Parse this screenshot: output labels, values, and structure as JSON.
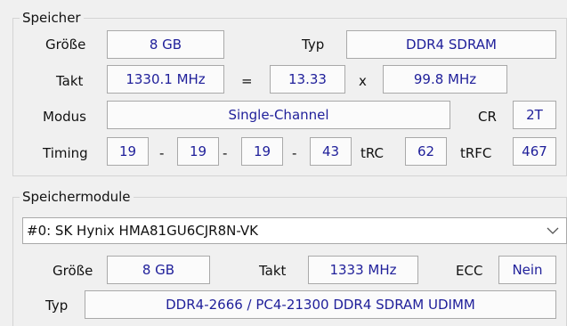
{
  "memory": {
    "title": "Speicher",
    "size_label": "Größe",
    "size_value": "8 GB",
    "type_label": "Typ",
    "type_value": "DDR4 SDRAM",
    "clock_label": "Takt",
    "clock_value": "1330.1 MHz",
    "equals": "=",
    "multiplier": "13.33",
    "times": "x",
    "base_clock": "99.8 MHz",
    "mode_label": "Modus",
    "mode_value": "Single-Channel",
    "cr_label": "CR",
    "cr_value": "2T",
    "timing_label": "Timing",
    "timings": [
      "19",
      "19",
      "19",
      "43"
    ],
    "dash": "-",
    "trc_label": "tRC",
    "trc_value": "62",
    "trfc_label": "tRFC",
    "trfc_value": "467"
  },
  "modules": {
    "title": "Speichermodule",
    "selected": "#0: SK Hynix HMA81GU6CJR8N-VK",
    "size_label": "Größe",
    "size_value": "8 GB",
    "clock_label": "Takt",
    "clock_value": "1333 MHz",
    "ecc_label": "ECC",
    "ecc_value": "Nein",
    "type_label": "Typ",
    "type_value": "DDR4-2666 / PC4-21300 DDR4 SDRAM UDIMM"
  }
}
